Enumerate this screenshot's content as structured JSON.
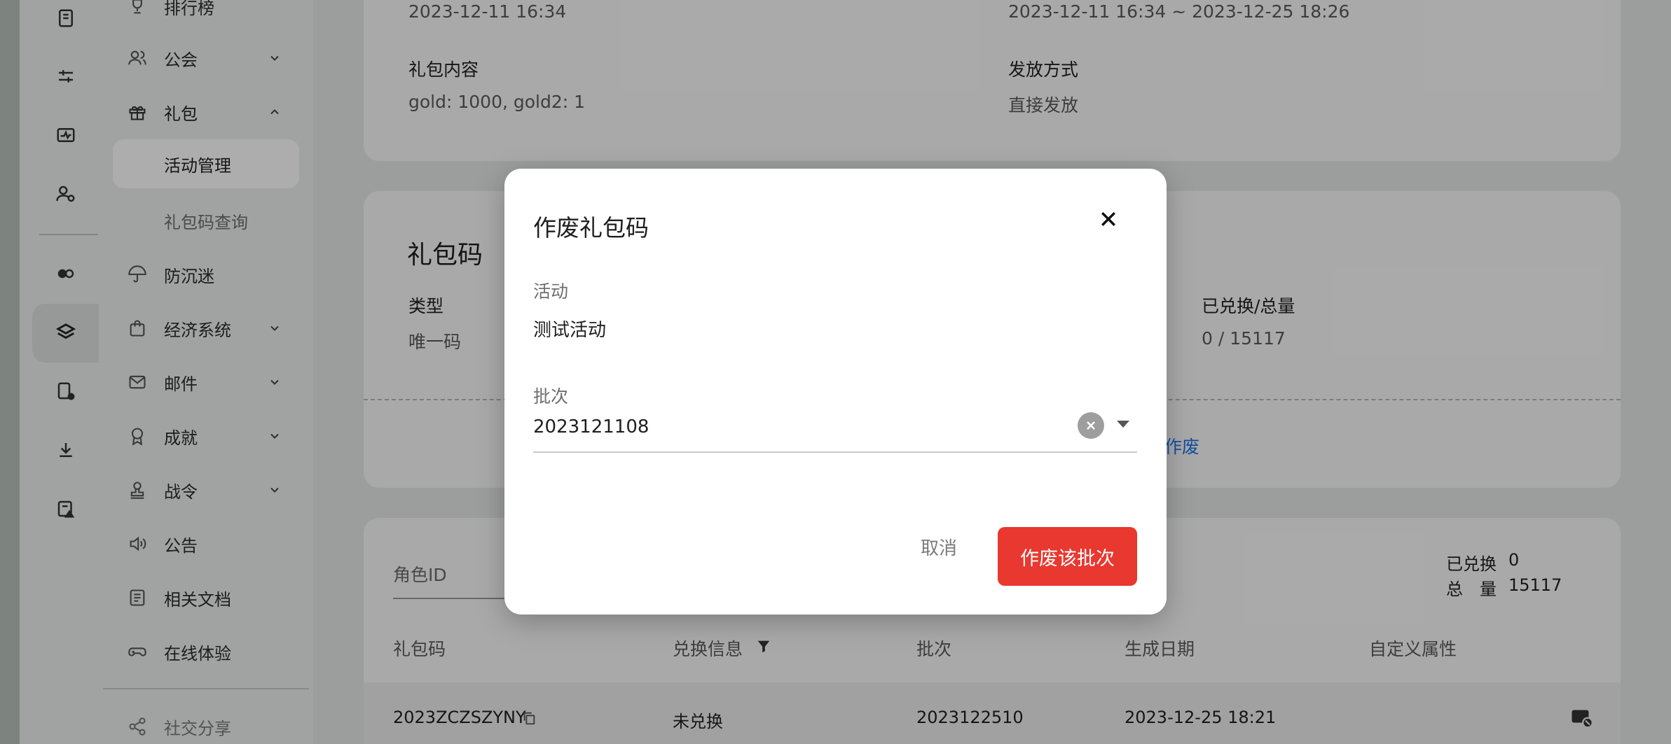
{
  "sidebar": {
    "items": [
      {
        "label": "排行榜",
        "icon": "trophy-icon"
      },
      {
        "label": "公会",
        "icon": "users-icon"
      },
      {
        "label": "礼包",
        "icon": "gift-icon"
      },
      {
        "label": "防沉迷",
        "icon": "umbrella-icon"
      },
      {
        "label": "经济系统",
        "icon": "shopping-bag-icon"
      },
      {
        "label": "邮件",
        "icon": "mail-icon"
      },
      {
        "label": "成就",
        "icon": "award-icon"
      },
      {
        "label": "战令",
        "icon": "stamp-icon"
      },
      {
        "label": "公告",
        "icon": "speaker-icon"
      },
      {
        "label": "相关文档",
        "icon": "document-icon"
      },
      {
        "label": "在线体验",
        "icon": "gamepad-icon"
      },
      {
        "label": "社交分享",
        "icon": "share-icon"
      }
    ],
    "sub_items": [
      {
        "label": "活动管理",
        "active": true
      },
      {
        "label": "礼包码查询",
        "active": false
      }
    ]
  },
  "activity_card": {
    "start_time": "2023-12-11 16:34",
    "period": "2023-12-11 16:34 ~ 2023-12-25 18:26",
    "content_label": "礼包内容",
    "content_value": "gold: 1000, gold2: 1",
    "distribution_label": "发放方式",
    "distribution_value": "直接发放"
  },
  "code_card": {
    "heading": "礼包码",
    "type_label": "类型",
    "type_value": "唯一码",
    "redeemed_label": "已兑换/总量",
    "redeemed_value": "0 / 15117",
    "void_link": "作废"
  },
  "list_card": {
    "role_id_label": "角色ID",
    "redeemed_label": "已兑换",
    "redeemed_count": "0",
    "total_label": "总　量",
    "total_count": "15117",
    "columns": [
      "礼包码",
      "兑换信息",
      "批次",
      "生成日期",
      "自定义属性"
    ],
    "rows": [
      {
        "code": "2023ZCZSZYNY",
        "status": "未兑换",
        "batch": "2023122510",
        "date": "2023-12-25 18:21"
      }
    ]
  },
  "dialog": {
    "title": "作废礼包码",
    "activity_label": "活动",
    "activity_value": "测试活动",
    "batch_label": "批次",
    "batch_value": "2023121108",
    "cancel_label": "取消",
    "confirm_label": "作废该批次"
  },
  "colors": {
    "danger": "#e8382f",
    "link": "#1a73e8",
    "overlay": "rgba(0,0,0,0.32)"
  }
}
